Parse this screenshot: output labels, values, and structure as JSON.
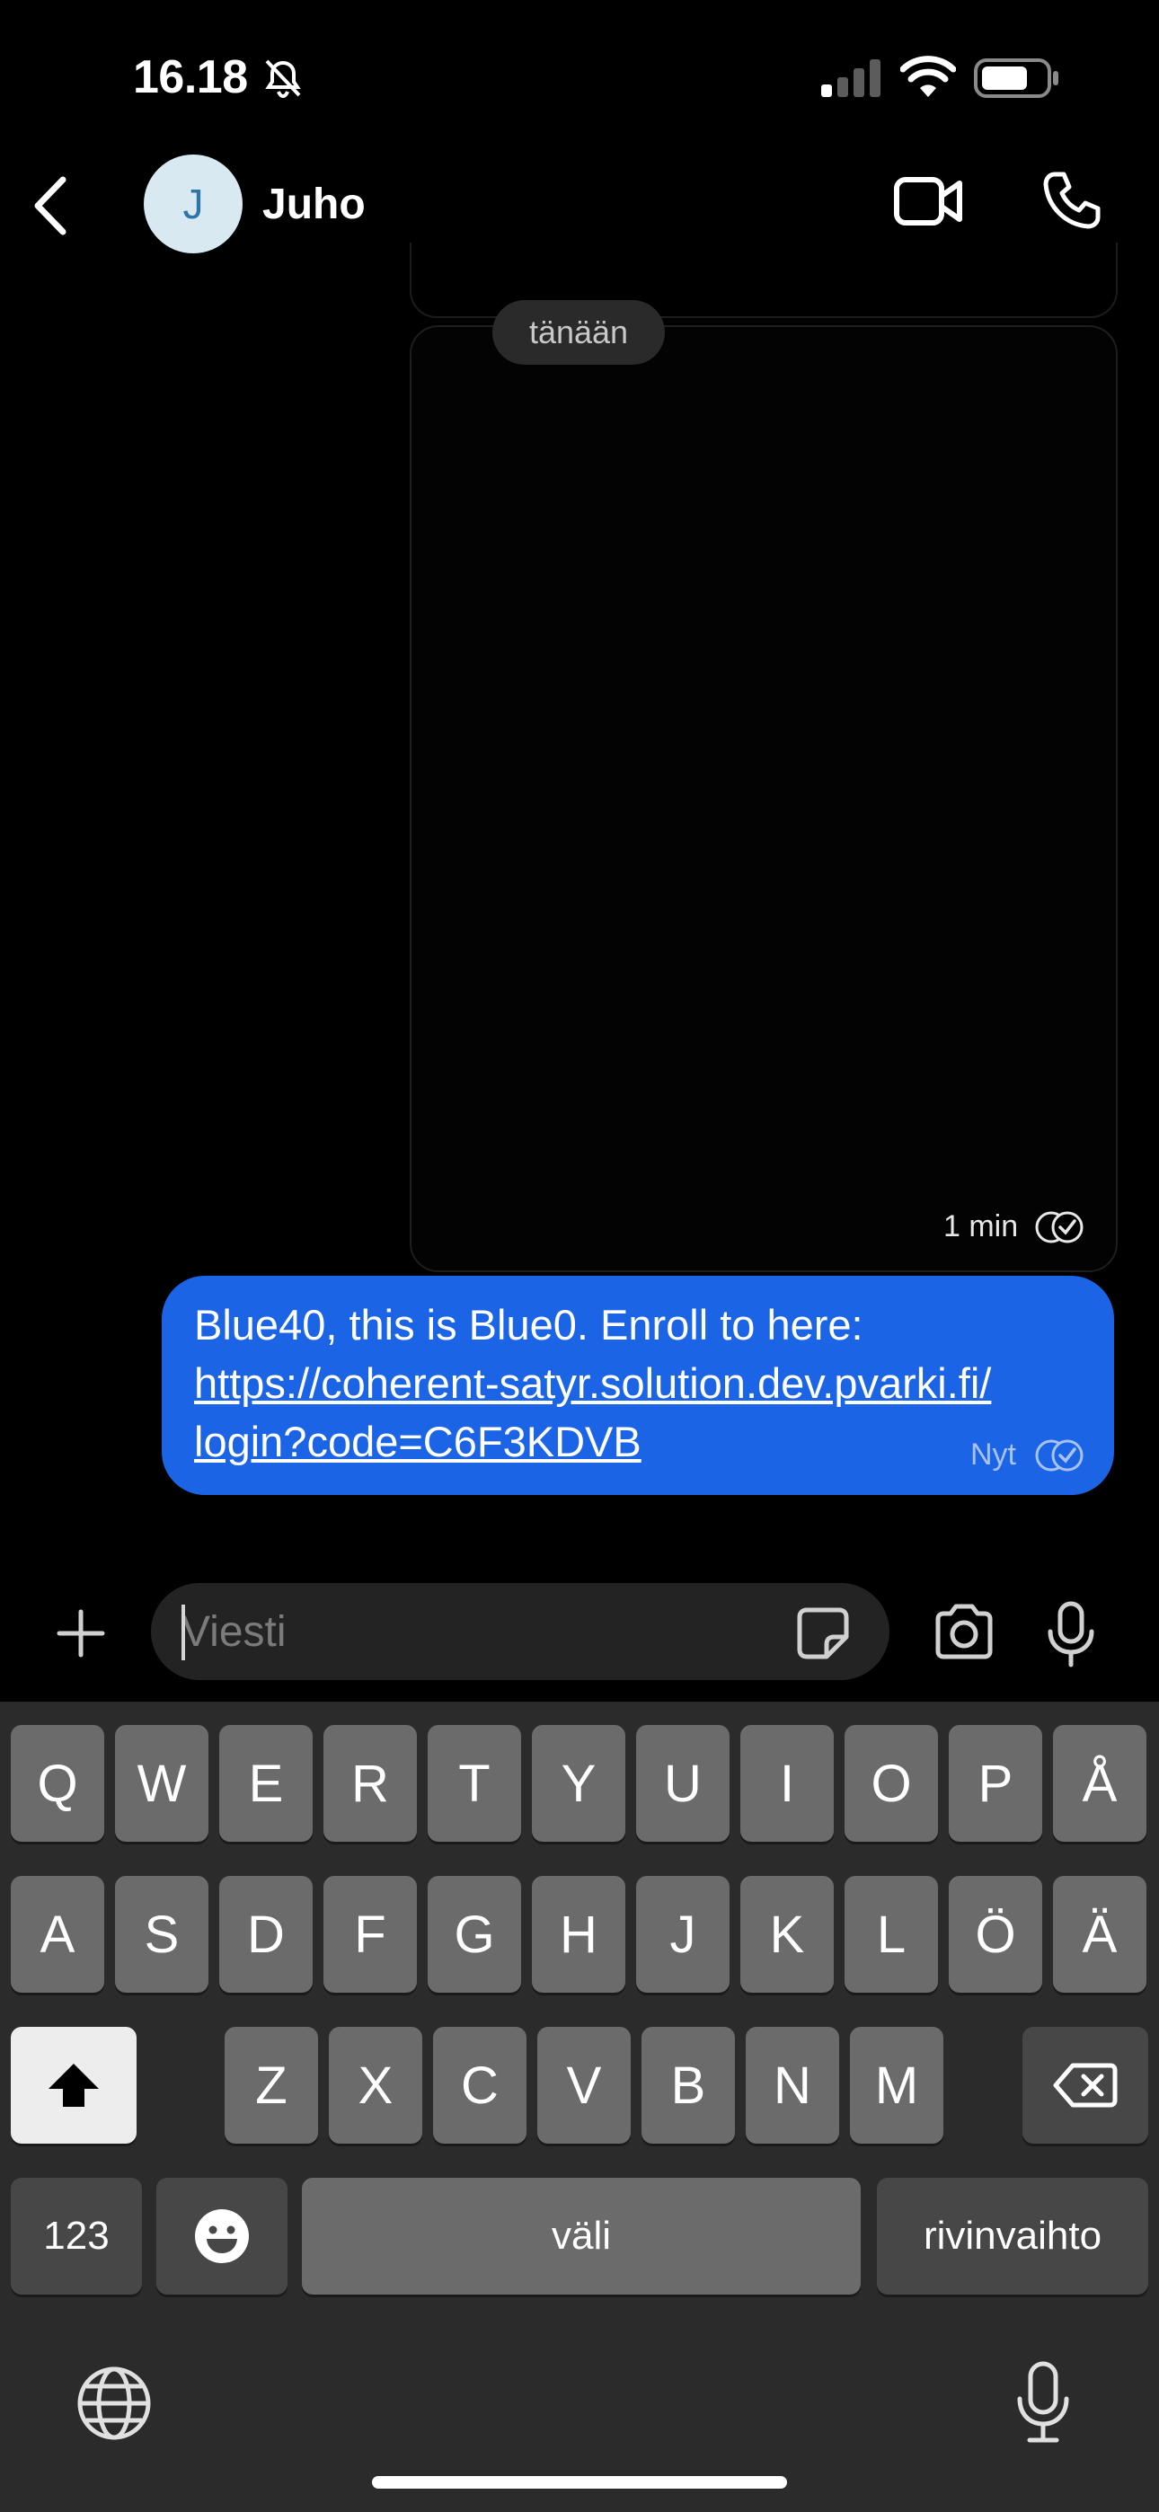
{
  "status_bar": {
    "time": "16.18"
  },
  "header": {
    "avatar_initial": "J",
    "contact_name": "Juho"
  },
  "chat": {
    "date_separator": "tänään",
    "media_message": {
      "time": "1 min"
    },
    "text_message": {
      "line1": "Blue40, this is Blue0. Enroll to here:",
      "link_line1": "https://coherent-satyr.solution.dev.pvarki.fi/",
      "link_line2": "login?code=C6F3KDVB",
      "time": "Nyt"
    }
  },
  "composer": {
    "placeholder": "Viesti"
  },
  "keyboard": {
    "row1": [
      "Q",
      "W",
      "E",
      "R",
      "T",
      "Y",
      "U",
      "I",
      "O",
      "P",
      "Å"
    ],
    "row2": [
      "A",
      "S",
      "D",
      "F",
      "G",
      "H",
      "J",
      "K",
      "L",
      "Ö",
      "Ä"
    ],
    "row3": [
      "Z",
      "X",
      "C",
      "V",
      "B",
      "N",
      "M"
    ],
    "numbers_key": "123",
    "space_key": "väli",
    "return_key": "rivinvaihto"
  },
  "colors": {
    "bubble": "#1b64e6",
    "background": "#000000",
    "keyboard": "#2b2b2b"
  },
  "icons": [
    "bell-muted-icon",
    "signal-icon",
    "wifi-icon",
    "battery-icon",
    "back-icon",
    "video-call-icon",
    "phone-icon",
    "double-check-icon",
    "plus-icon",
    "sticker-icon",
    "camera-icon",
    "mic-icon",
    "emoji-icon",
    "shift-icon",
    "backspace-icon",
    "globe-icon",
    "dictation-icon"
  ]
}
